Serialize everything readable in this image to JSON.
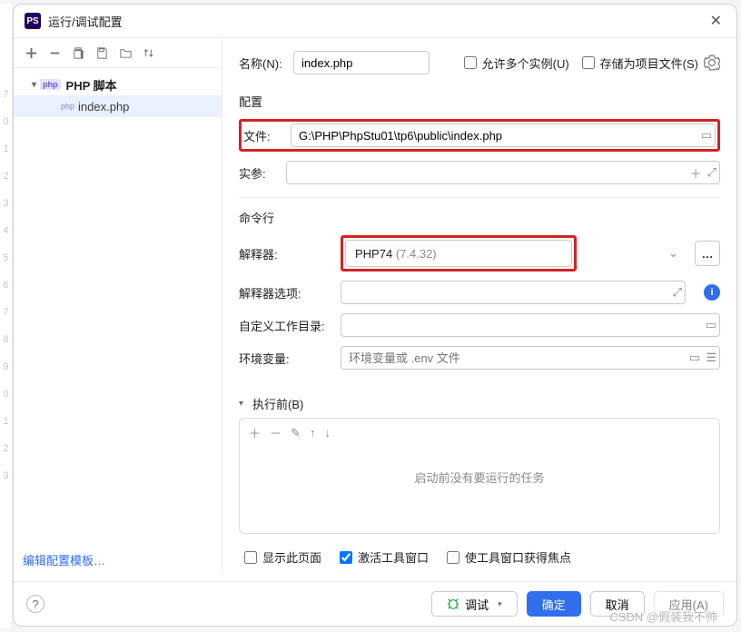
{
  "title": "运行/调试配置",
  "gutter_lines": [
    "7",
    "0",
    "1",
    "2",
    "3",
    "4",
    "5",
    "6",
    "7",
    "8",
    "9",
    "0",
    "1",
    "2",
    "3"
  ],
  "tree": {
    "parent_label": "PHP 脚本",
    "child_label": "index.php"
  },
  "form": {
    "name_label": "名称(N):",
    "name_value": "index.php",
    "allow_multi_label": "允许多个实例(U)",
    "store_project_label": "存储为项目文件(S)",
    "config_section": "配置",
    "file_label": "文件:",
    "file_value": "G:\\PHP\\PhpStu01\\tp6\\public\\index.php",
    "args_label": "实参:",
    "args_value": "",
    "cli_section": "命令行",
    "interpreter_label": "解释器:",
    "interpreter_name": "PHP74",
    "interpreter_version": "(7.4.32)",
    "interp_opts_label": "解释器选项:",
    "interp_opts_value": "",
    "workdir_label": "自定义工作目录:",
    "workdir_value": "",
    "env_label": "环境变量:",
    "env_placeholder": "环境变量或 .env 文件",
    "before_label": "执行前(B)",
    "before_empty": "启动前没有要运行的任务",
    "cb_show_page": "显示此页面",
    "cb_activate_tool": "激活工具窗口",
    "cb_focus_tool": "使工具窗口获得焦点"
  },
  "footer": {
    "edit_template": "编辑配置模板…",
    "debug_label": "调试",
    "ok_label": "确定",
    "cancel_label": "取消",
    "apply_label": "应用(A)"
  },
  "watermark": "CSDN @假装我不帅"
}
